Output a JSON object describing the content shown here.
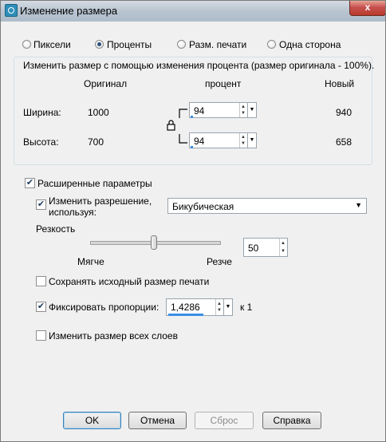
{
  "window": {
    "title": "Изменение размера",
    "close_label": "x"
  },
  "mode": {
    "options": [
      "Пиксели",
      "Проценты",
      "Разм. печати",
      "Одна сторона"
    ],
    "selected": "Проценты"
  },
  "resize": {
    "group_title": "Изменить размер с помощью изменения процента (размер оригинала - 100%).",
    "col_original": "Оригинал",
    "col_percent": "процент",
    "col_new": "Новый",
    "width_label": "Ширина:",
    "width_original": "1000",
    "width_percent": "94",
    "width_new": "940",
    "height_label": "Высота:",
    "height_original": "700",
    "height_percent": "94",
    "height_new": "658"
  },
  "advanced": {
    "label": "Расширенные параметры",
    "checked": true,
    "resample_label_1": "Изменить разрешение,",
    "resample_label_2": "используя:",
    "resample_checked": true,
    "resample_method": "Бикубическая",
    "sharpness_label": "Резкость",
    "sharpness_soft": "Мягче",
    "sharpness_sharp": "Резче",
    "sharpness_value": "50",
    "keep_print_label": "Сохранять исходный размер печати",
    "keep_print_checked": false,
    "lock_ratio_label": "Фиксировать пропорции:",
    "lock_ratio_checked": true,
    "ratio_value": "1,4286",
    "ratio_suffix": "к 1",
    "all_layers_label": "Изменить размер всех слоев",
    "all_layers_checked": false
  },
  "buttons": {
    "ok": "OK",
    "cancel": "Отмена",
    "reset": "Сброс",
    "help": "Справка"
  }
}
